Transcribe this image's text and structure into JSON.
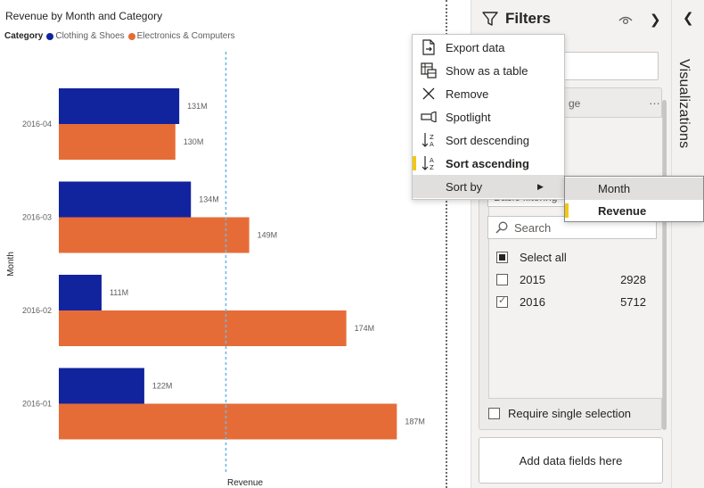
{
  "chart_data": {
    "type": "bar",
    "orientation": "horizontal",
    "title": "Revenue by Month and Category",
    "legend_title": "Category",
    "xlabel": "Revenue",
    "ylabel": "Month",
    "categories": [
      "2016-04",
      "2016-03",
      "2016-02",
      "2016-01"
    ],
    "series": [
      {
        "name": "Clothing & Shoes",
        "color": "#12239e",
        "values": [
          131,
          134,
          111,
          122
        ],
        "labels": [
          "131M",
          "134M",
          "111M",
          "122M"
        ]
      },
      {
        "name": "Electronics & Computers",
        "color": "#e66c37",
        "values": [
          130,
          149,
          174,
          187
        ],
        "labels": [
          "130M",
          "149M",
          "174M",
          "187M"
        ]
      }
    ],
    "xlim": [
      100,
      190
    ],
    "reference_line": 143,
    "legend_position": "top-left",
    "grid": false
  },
  "filters": {
    "title": "Filters",
    "card_title": "ge",
    "card_more": "…",
    "filter_type": "Basic filtering",
    "search_placeholder": "Search",
    "options": [
      {
        "label": "Select all",
        "count": "",
        "state": "partial"
      },
      {
        "label": "2015",
        "count": "2928",
        "state": "unchecked"
      },
      {
        "label": "2016",
        "count": "5712",
        "state": "checked"
      }
    ],
    "require_single": "Require single selection",
    "add_fields": "Add data fields here"
  },
  "viz_tab": {
    "label": "Visualizations"
  },
  "context_menu": {
    "items": [
      {
        "label": "Export data",
        "icon": "export-icon",
        "active": false
      },
      {
        "label": "Show as a table",
        "icon": "table-icon",
        "active": false
      },
      {
        "label": "Remove",
        "icon": "close-icon",
        "active": false
      },
      {
        "label": "Spotlight",
        "icon": "spotlight-icon",
        "active": false
      },
      {
        "label": "Sort descending",
        "icon": "sort-descending-icon",
        "active": false
      },
      {
        "label": "Sort ascending",
        "icon": "sort-ascending-icon",
        "active": true
      },
      {
        "label": "Sort by",
        "icon": "",
        "active": false,
        "hover": true,
        "submenu": true
      }
    ],
    "submenu": [
      {
        "label": "Month",
        "hover": true,
        "active": false
      },
      {
        "label": "Revenue",
        "hover": false,
        "active": true
      }
    ]
  },
  "colors": {
    "accent": "#f2c811",
    "series1": "#12239e",
    "series2": "#e66c37",
    "reference_line": "#6fb7e3"
  }
}
